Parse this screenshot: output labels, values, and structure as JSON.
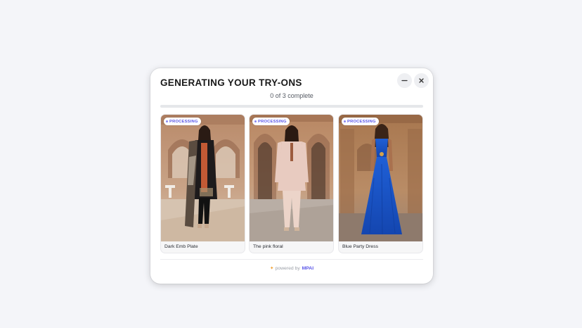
{
  "modal": {
    "title": "GENERATING YOUR TRY-ONS",
    "status": "0 of 3 complete",
    "progress": 0,
    "minimize_icon": "minus-icon",
    "close_icon": "close-icon"
  },
  "cards": [
    {
      "label": "Dark Emb Plate",
      "badge": "PROCESSING",
      "image": "model-wearing-dark-embroidered-kurta"
    },
    {
      "label": "The pink floral",
      "badge": "PROCESSING",
      "image": "model-wearing-pink-floral-suit"
    },
    {
      "label": "Blue Party Dress",
      "badge": "PROCESSING",
      "image": "model-wearing-blue-gown"
    }
  ],
  "footer": {
    "prefix": "powered by",
    "brand": "MPAI",
    "icon": "sparkle-icon"
  },
  "colors": {
    "accent": "#5b57e8",
    "background": "#f4f5f9"
  }
}
